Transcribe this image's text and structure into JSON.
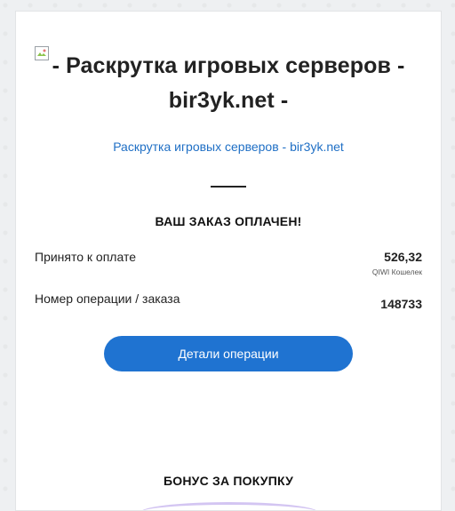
{
  "header": {
    "image_icon": "broken-image-icon",
    "title": "- Раскрутка игровых серверов - bir3yk.net -",
    "site_link": "Раскрутка игровых серверов - bir3yk.net"
  },
  "order": {
    "status_heading": "ВАШ ЗАКАЗ ОПЛАЧЕН!",
    "accepted_label": "Принято к оплате",
    "accepted_amount": "526,32",
    "payment_method": "QIWI Кошелек",
    "operation_label": "Номер операции / заказа",
    "operation_number": "148733"
  },
  "actions": {
    "details_button": "Детали операции"
  },
  "bonus": {
    "heading": "БОНУС ЗА ПОКУПКУ"
  },
  "colors": {
    "link": "#1f6fc5",
    "button": "#1f73d1",
    "page_background": "#eef0f2"
  }
}
